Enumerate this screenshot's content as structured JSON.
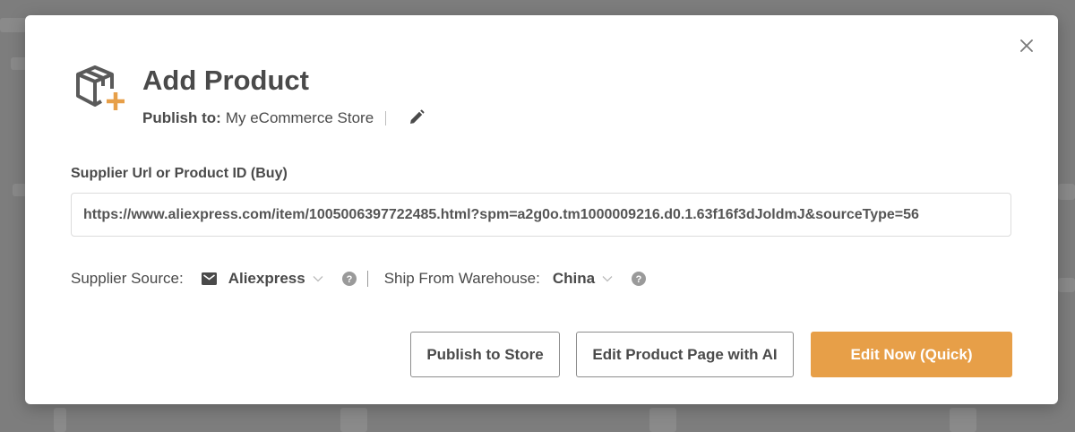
{
  "modal": {
    "title": "Add Product",
    "publish_label": "Publish to:",
    "store_name": "My eCommerce Store",
    "url_field": {
      "label": "Supplier Url or Product ID (Buy)",
      "value": "https://www.aliexpress.com/item/1005006397722485.html?spm=a2g0o.tm1000009216.d0.1.63f16f3dJoldmJ&sourceType=56"
    },
    "supplier_source": {
      "label": "Supplier Source:",
      "value": "Aliexpress"
    },
    "ship_from": {
      "label": "Ship From Warehouse:",
      "value": "China"
    },
    "buttons": {
      "publish": "Publish to Store",
      "edit_ai": "Edit Product Page with AI",
      "edit_now": "Edit Now (Quick)"
    }
  },
  "icons": {
    "header": "package-add-icon",
    "close": "close-icon",
    "edit": "pencil-icon",
    "source": "mail-icon",
    "dropdown": "chevron-down-icon",
    "help": "question-circle-icon"
  },
  "colors": {
    "accent": "#e79f48",
    "text": "#4a4a4a",
    "backdrop": "#7d7d7d"
  }
}
